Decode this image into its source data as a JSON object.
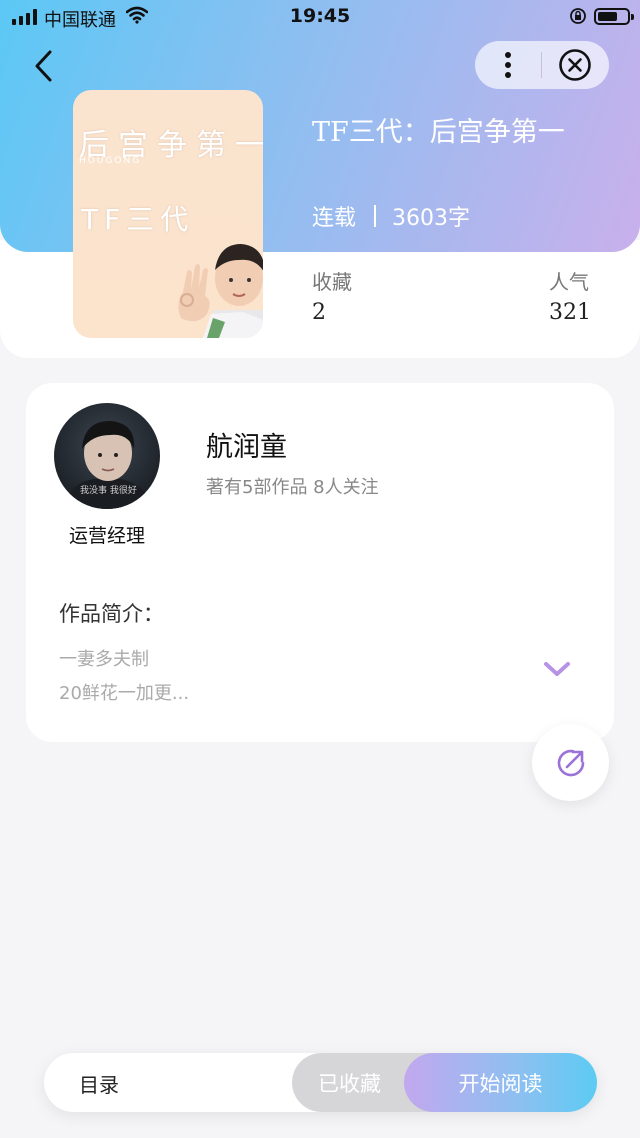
{
  "status_bar": {
    "carrier": "中国联通",
    "time": "19:45"
  },
  "book": {
    "cover_title": "后宫争第一",
    "cover_subtitle": "HOUGONG",
    "cover_generation": "TF三代",
    "title": "TF三代：后宫争第一",
    "status": "连载",
    "word_count": "3603字",
    "favorites_label": "收藏",
    "favorites_value": "2",
    "popularity_label": "人气",
    "popularity_value": "321"
  },
  "author": {
    "role": "运营经理",
    "name": "航润童",
    "stats": "著有5部作品 8人关注",
    "avatar_caption": "我没事 我很好"
  },
  "intro": {
    "label": "作品简介：",
    "lines": [
      "一妻多夫制",
      "20鲜花一加更..."
    ]
  },
  "bottom_bar": {
    "toc_label": "目录",
    "collected_label": "已收藏",
    "read_label": "开始阅读"
  },
  "colors": {
    "gradient_start": "#5cc8f5",
    "gradient_end": "#c9b0ec",
    "accent_purple": "#a37fe0"
  },
  "icons": [
    "back-icon",
    "more-icon",
    "close-icon",
    "chevron-down-icon",
    "share-icon"
  ]
}
